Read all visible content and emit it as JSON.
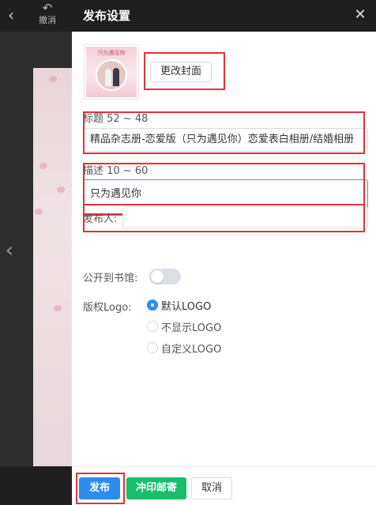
{
  "editor": {
    "back_icon": "chevron-left-icon",
    "undo_label": "撤消",
    "side_arrow_icon": "chevron-left-icon"
  },
  "panel": {
    "title": "发布设置",
    "cover": {
      "text": "只为遇见你",
      "change_button": "更改封面"
    },
    "title_field": {
      "label": "标题 52 ~ 48",
      "value": "精品杂志册-恋爱版（只为遇见你）恋爱表白相册/结婚相册"
    },
    "description_field": {
      "label": "描述 10 ~ 60",
      "value": "只为遇见你"
    },
    "publisher_field": {
      "label": "发布人:",
      "value": ""
    },
    "public_library": {
      "label": "公开到书馆:",
      "enabled": false
    },
    "copyright_logo": {
      "label": "版权Logo:",
      "options": [
        "默认LOGO",
        "不显示LOGO",
        "自定义LOGO"
      ],
      "selected": "默认LOGO"
    },
    "footer": {
      "publish": "发布",
      "print": "冲印邮寄",
      "cancel": "取消"
    }
  },
  "colors": {
    "primary": "#2d8cf0",
    "success": "#19be6b",
    "highlight": "#e1323c",
    "header": "#1f1f1f"
  }
}
